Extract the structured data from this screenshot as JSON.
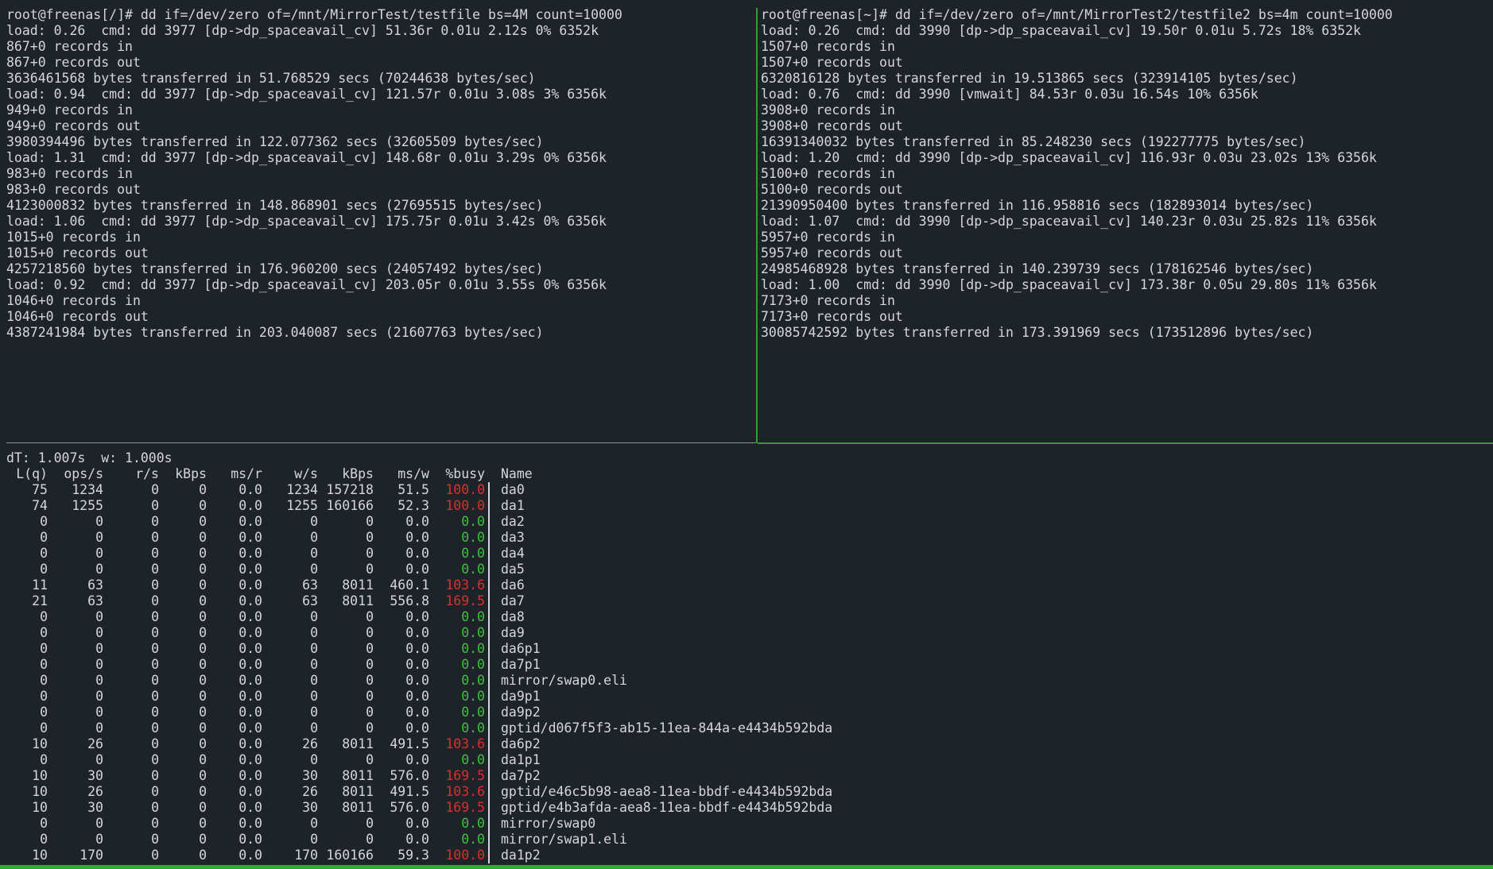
{
  "left_pane": {
    "lines": [
      "root@freenas[/]# dd if=/dev/zero of=/mnt/MirrorTest/testfile bs=4M count=10000",
      "load: 0.26  cmd: dd 3977 [dp->dp_spaceavail_cv] 51.36r 0.01u 2.12s 0% 6352k",
      "867+0 records in",
      "867+0 records out",
      "3636461568 bytes transferred in 51.768529 secs (70244638 bytes/sec)",
      "load: 0.94  cmd: dd 3977 [dp->dp_spaceavail_cv] 121.57r 0.01u 3.08s 3% 6356k",
      "949+0 records in",
      "949+0 records out",
      "3980394496 bytes transferred in 122.077362 secs (32605509 bytes/sec)",
      "load: 1.31  cmd: dd 3977 [dp->dp_spaceavail_cv] 148.68r 0.01u 3.29s 0% 6356k",
      "983+0 records in",
      "983+0 records out",
      "4123000832 bytes transferred in 148.868901 secs (27695515 bytes/sec)",
      "load: 1.06  cmd: dd 3977 [dp->dp_spaceavail_cv] 175.75r 0.01u 3.42s 0% 6356k",
      "1015+0 records in",
      "1015+0 records out",
      "4257218560 bytes transferred in 176.960200 secs (24057492 bytes/sec)",
      "load: 0.92  cmd: dd 3977 [dp->dp_spaceavail_cv] 203.05r 0.01u 3.55s 0% 6356k",
      "1046+0 records in",
      "1046+0 records out",
      "4387241984 bytes transferred in 203.040087 secs (21607763 bytes/sec)"
    ]
  },
  "right_pane": {
    "lines": [
      "root@freenas[~]# dd if=/dev/zero of=/mnt/MirrorTest2/testfile2 bs=4m count=10000",
      "load: 0.26  cmd: dd 3990 [dp->dp_spaceavail_cv] 19.50r 0.01u 5.72s 18% 6352k",
      "1507+0 records in",
      "1507+0 records out",
      "6320816128 bytes transferred in 19.513865 secs (323914105 bytes/sec)",
      "load: 0.76  cmd: dd 3990 [vmwait] 84.53r 0.03u 16.54s 10% 6356k",
      "3908+0 records in",
      "3908+0 records out",
      "16391340032 bytes transferred in 85.248230 secs (192277775 bytes/sec)",
      "load: 1.20  cmd: dd 3990 [dp->dp_spaceavail_cv] 116.93r 0.03u 23.02s 13% 6356k",
      "5100+0 records in",
      "5100+0 records out",
      "21390950400 bytes transferred in 116.958816 secs (182893014 bytes/sec)",
      "load: 1.07  cmd: dd 3990 [dp->dp_spaceavail_cv] 140.23r 0.03u 25.82s 11% 6356k",
      "5957+0 records in",
      "5957+0 records out",
      "24985468928 bytes transferred in 140.239739 secs (178162546 bytes/sec)",
      "load: 1.00  cmd: dd 3990 [dp->dp_spaceavail_cv] 173.38r 0.05u 29.80s 11% 6356k",
      "7173+0 records in",
      "7173+0 records out",
      "30085742592 bytes transferred in 173.391969 secs (173512896 bytes/sec)"
    ]
  },
  "gstat": {
    "summary": "dT: 1.007s  w: 1.000s",
    "headers": [
      "L(q)",
      "ops/s",
      "r/s",
      "kBps",
      "ms/r",
      "w/s",
      "kBps",
      "ms/w",
      "%busy",
      "Name"
    ],
    "rows": [
      [
        "75",
        "1234",
        "0",
        "0",
        "0.0",
        "1234",
        "157218",
        "51.5",
        "100.0",
        "da0",
        "red"
      ],
      [
        "74",
        "1255",
        "0",
        "0",
        "0.0",
        "1255",
        "160166",
        "52.3",
        "100.0",
        "da1",
        "red"
      ],
      [
        "0",
        "0",
        "0",
        "0",
        "0.0",
        "0",
        "0",
        "0.0",
        "0.0",
        "da2",
        "green"
      ],
      [
        "0",
        "0",
        "0",
        "0",
        "0.0",
        "0",
        "0",
        "0.0",
        "0.0",
        "da3",
        "green"
      ],
      [
        "0",
        "0",
        "0",
        "0",
        "0.0",
        "0",
        "0",
        "0.0",
        "0.0",
        "da4",
        "green"
      ],
      [
        "0",
        "0",
        "0",
        "0",
        "0.0",
        "0",
        "0",
        "0.0",
        "0.0",
        "da5",
        "green"
      ],
      [
        "11",
        "63",
        "0",
        "0",
        "0.0",
        "63",
        "8011",
        "460.1",
        "103.6",
        "da6",
        "red"
      ],
      [
        "21",
        "63",
        "0",
        "0",
        "0.0",
        "63",
        "8011",
        "556.8",
        "169.5",
        "da7",
        "red"
      ],
      [
        "0",
        "0",
        "0",
        "0",
        "0.0",
        "0",
        "0",
        "0.0",
        "0.0",
        "da8",
        "green"
      ],
      [
        "0",
        "0",
        "0",
        "0",
        "0.0",
        "0",
        "0",
        "0.0",
        "0.0",
        "da9",
        "green"
      ],
      [
        "0",
        "0",
        "0",
        "0",
        "0.0",
        "0",
        "0",
        "0.0",
        "0.0",
        "da6p1",
        "green"
      ],
      [
        "0",
        "0",
        "0",
        "0",
        "0.0",
        "0",
        "0",
        "0.0",
        "0.0",
        "da7p1",
        "green"
      ],
      [
        "0",
        "0",
        "0",
        "0",
        "0.0",
        "0",
        "0",
        "0.0",
        "0.0",
        "mirror/swap0.eli",
        "green"
      ],
      [
        "0",
        "0",
        "0",
        "0",
        "0.0",
        "0",
        "0",
        "0.0",
        "0.0",
        "da9p1",
        "green"
      ],
      [
        "0",
        "0",
        "0",
        "0",
        "0.0",
        "0",
        "0",
        "0.0",
        "0.0",
        "da9p2",
        "green"
      ],
      [
        "0",
        "0",
        "0",
        "0",
        "0.0",
        "0",
        "0",
        "0.0",
        "0.0",
        "gptid/d067f5f3-ab15-11ea-844a-e4434b592bda",
        "green"
      ],
      [
        "10",
        "26",
        "0",
        "0",
        "0.0",
        "26",
        "8011",
        "491.5",
        "103.6",
        "da6p2",
        "red"
      ],
      [
        "0",
        "0",
        "0",
        "0",
        "0.0",
        "0",
        "0",
        "0.0",
        "0.0",
        "da1p1",
        "green"
      ],
      [
        "10",
        "30",
        "0",
        "0",
        "0.0",
        "30",
        "8011",
        "576.0",
        "169.5",
        "da7p2",
        "red"
      ],
      [
        "10",
        "26",
        "0",
        "0",
        "0.0",
        "26",
        "8011",
        "491.5",
        "103.6",
        "gptid/e46c5b98-aea8-11ea-bbdf-e4434b592bda",
        "red"
      ],
      [
        "10",
        "30",
        "0",
        "0",
        "0.0",
        "30",
        "8011",
        "576.0",
        "169.5",
        "gptid/e4b3afda-aea8-11ea-bbdf-e4434b592bda",
        "red"
      ],
      [
        "0",
        "0",
        "0",
        "0",
        "0.0",
        "0",
        "0",
        "0.0",
        "0.0",
        "mirror/swap0",
        "green"
      ],
      [
        "0",
        "0",
        "0",
        "0",
        "0.0",
        "0",
        "0",
        "0.0",
        "0.0",
        "mirror/swap1.eli",
        "green"
      ],
      [
        "10",
        "170",
        "0",
        "0",
        "0.0",
        "170",
        "160166",
        "59.3",
        "100.0",
        "da1p2",
        "red"
      ]
    ]
  },
  "colors": {
    "background": "#1e2229",
    "text": "#d4d7dc",
    "busy_high": "#d9302b",
    "busy_idle": "#3ec23e",
    "tmux_active_border": "#2e9e2e",
    "tmux_status_bar": "#35a935"
  }
}
